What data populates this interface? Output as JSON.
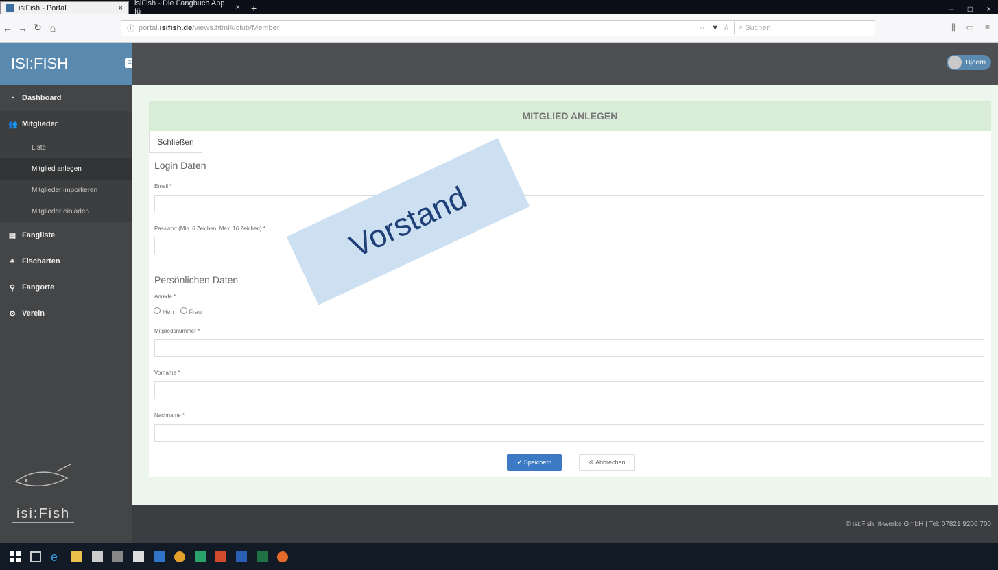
{
  "browser": {
    "tabs": [
      {
        "title": "isiFish - Portal",
        "close": "×"
      },
      {
        "title": "isiFish - Die Fangbuch App fü",
        "close": "×"
      }
    ],
    "new_tab": "+",
    "window_controls": [
      "–",
      "□",
      "×"
    ],
    "url": {
      "prefix": "portal.",
      "host": "isifish.de",
      "path": "/views.html#/club/Member"
    },
    "url_more": "···",
    "search_placeholder": "Suchen"
  },
  "app": {
    "logo": "ISI:FISH",
    "user_name": "Bjoern",
    "sidebar": {
      "items": [
        {
          "label": "Dashboard",
          "icon": "dashboard-icon"
        },
        {
          "label": "Mitglieder",
          "icon": "users-icon"
        },
        {
          "label": "Liste"
        },
        {
          "label": "Mitglied anlegen"
        },
        {
          "label": "Mitglieder importieren"
        },
        {
          "label": "Mitglieder einladen"
        },
        {
          "label": "Fangliste",
          "icon": "list-icon"
        },
        {
          "label": "Fischarten",
          "icon": "fish-icon"
        },
        {
          "label": "Fangorte",
          "icon": "pin-icon"
        },
        {
          "label": "Verein",
          "icon": "gears-icon"
        }
      ],
      "logo_word": "isi:Fish"
    },
    "page_title": "MITGLIED ANLEGEN",
    "close_tab": "Schließen",
    "form": {
      "login_section": "Login Daten",
      "email_label": "Email *",
      "password_label": "Passwort (Min. 6 Zeichen, Max. 16 Zeichen) *",
      "personal_section": "Persönlichen Daten",
      "salutation_label": "Anrede *",
      "salutation_options": [
        "Herr",
        "Frau"
      ],
      "member_number_label": "Mitgliedsnummer *",
      "firstname_label": "Vorname *",
      "lastname_label": "Nachname *",
      "save_button": "✔ Speichern",
      "cancel_button": "⊗ Abbrechen"
    },
    "footer": "© isi:Fish, it-werke GmbH | Tel: 07821 9206 700",
    "watermark": "Vorstand"
  },
  "colors": {
    "sidebar": "#444546",
    "brand": "#5a8ab0",
    "header_bg": "#d9ecd7",
    "primary_button": "#3c7bc4",
    "watermark_bg": "#cde0f2"
  }
}
